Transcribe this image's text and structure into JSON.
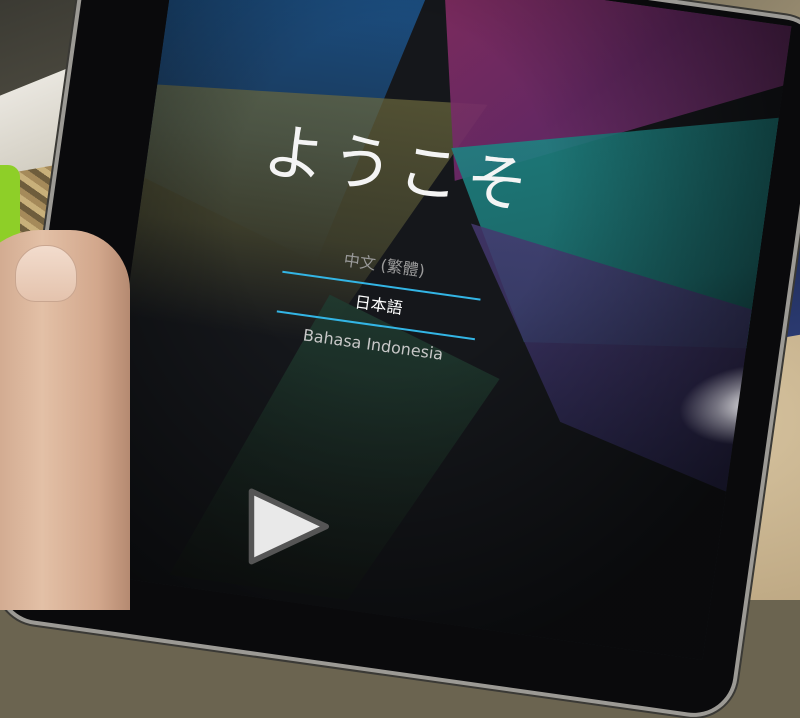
{
  "welcome_title": "ようこそ",
  "languages": [
    {
      "label": "中文 (繁體)",
      "state": "dim"
    },
    {
      "label": "日本語",
      "state": "selected"
    },
    {
      "label": "Bahasa Indonesia",
      "state": "normal"
    }
  ],
  "colors": {
    "divider_accent": "#33b5e5",
    "text_primary": "#ffffff"
  },
  "next_button_icon": "play-triangle-icon"
}
